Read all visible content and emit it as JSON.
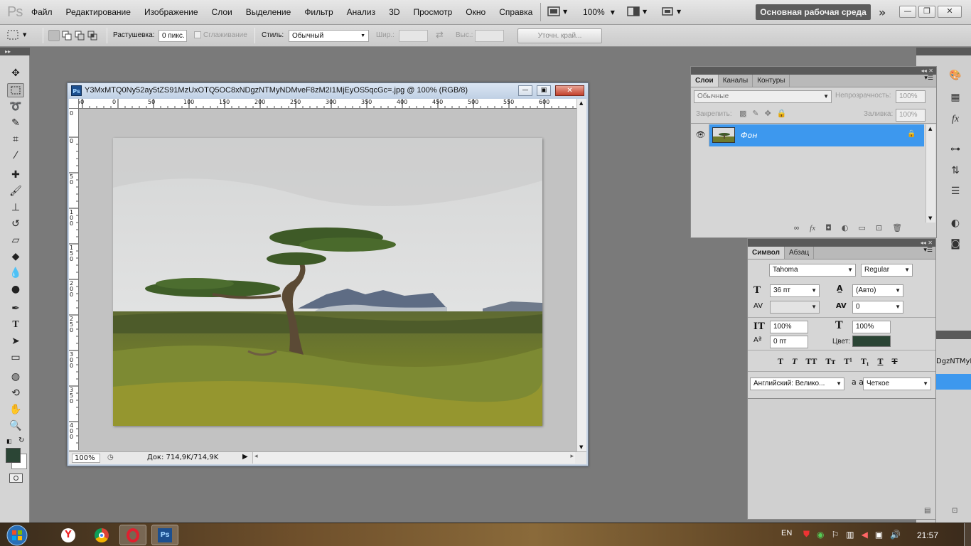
{
  "app": {
    "logo": "Ps"
  },
  "menu": [
    "Файл",
    "Редактирование",
    "Изображение",
    "Слои",
    "Выделение",
    "Фильтр",
    "Анализ",
    "3D",
    "Просмотр",
    "Окно",
    "Справка"
  ],
  "appbar": {
    "zoom": "100%",
    "workspace": "Основная рабочая среда"
  },
  "options": {
    "feather_label": "Растушевка:",
    "feather_value": "0 пикс.",
    "antialias_label": "Сглаживание",
    "style_label": "Стиль:",
    "style_value": "Обычный",
    "width_label": "Шир.:",
    "height_label": "Выс.:",
    "refine_edge": "Уточн. край..."
  },
  "document": {
    "title": "Y3MxMTQ0Ny52ay5tZS91MzUxOTQ5OC8xNDgzNTMyNDMveF8zM2I1MjEyOS5qcGc=.jpg @ 100% (RGB/8)",
    "zoom": "100%",
    "doc_info": "Док: 714,9K/714,9K",
    "ruler_h": [
      "50",
      "0",
      "50",
      "100",
      "150",
      "200",
      "250",
      "300",
      "350",
      "400",
      "450",
      "500",
      "550",
      "600"
    ],
    "ruler_v": [
      "0",
      "0",
      "5 0",
      "1 0 0",
      "1 5 0",
      "2 0 0",
      "2 5 0",
      "3 0 0",
      "3 5 0",
      "4 0 0"
    ]
  },
  "layers_panel": {
    "tabs": [
      "Слои",
      "Каналы",
      "Контуры"
    ],
    "blend_mode": "Обычные",
    "opacity_label": "Непрозрачность:",
    "opacity_value": "100%",
    "lock_label": "Закрепить:",
    "fill_label": "Заливка:",
    "fill_value": "100%",
    "layer_name": "Фон"
  },
  "char_panel": {
    "tabs": [
      "Символ",
      "Абзац"
    ],
    "font_family": "Tahoma",
    "font_style": "Regular",
    "font_size": "36 пт",
    "leading": "(Авто)",
    "kerning": "",
    "tracking": "0",
    "vscale": "100%",
    "hscale": "100%",
    "baseline": "0 пт",
    "color_label": "Цвет:",
    "color": "#2b4535",
    "language": "Английский: Велико...",
    "antialias_icon": "a a",
    "antialias": "Четкое"
  },
  "peek": {
    "filename_fragment": "DgzNTMyN..."
  },
  "taskbar": {
    "lang": "EN",
    "time": "21:57"
  }
}
